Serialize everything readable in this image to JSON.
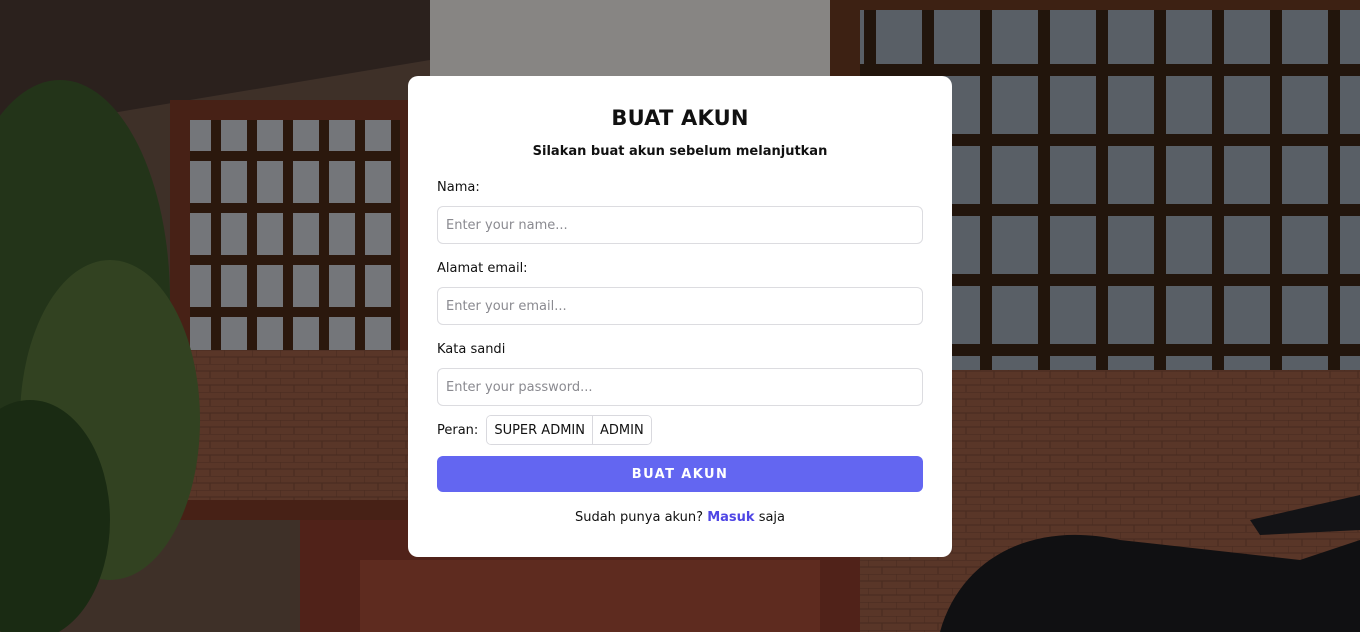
{
  "form": {
    "title": "BUAT AKUN",
    "subtitle": "Silakan buat akun sebelum melanjutkan",
    "name_label": "Nama:",
    "name_placeholder": "Enter your name...",
    "email_label": "Alamat email:",
    "email_placeholder": "Enter your email...",
    "password_label": "Kata sandi",
    "password_placeholder": "Enter your password...",
    "role_label": "Peran:",
    "roles": [
      "SUPER ADMIN",
      "ADMIN"
    ],
    "submit_label": "BUAT AKUN",
    "footer_prefix": "Sudah punya akun?",
    "footer_link": "Masuk",
    "footer_suffix": "saja"
  },
  "colors": {
    "primary": "#6366f1",
    "link": "#4f46e5",
    "card": "#ffffff"
  }
}
